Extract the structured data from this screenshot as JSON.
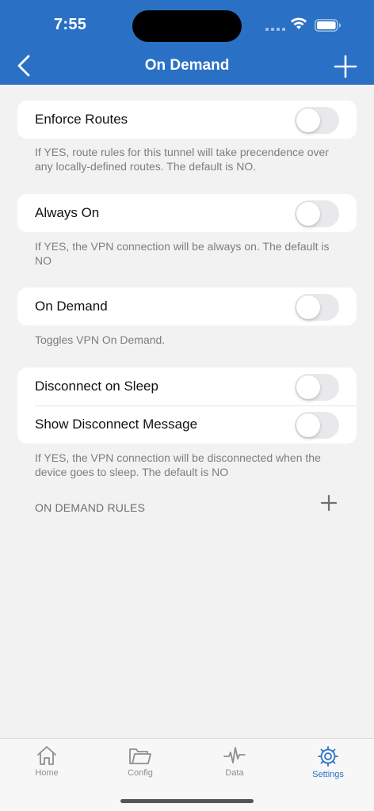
{
  "status_bar": {
    "time": "7:55"
  },
  "nav": {
    "title": "On Demand"
  },
  "groups": [
    {
      "label": "Enforce Routes",
      "enabled": false,
      "footnote": "If YES, route rules for this tunnel will take precendence over any locally-defined routes. The default is NO."
    },
    {
      "label": "Always On",
      "enabled": false,
      "footnote": "If YES, the VPN connection will be always on. The default is NO"
    },
    {
      "label": "On Demand",
      "enabled": false,
      "footnote": "Toggles VPN On Demand."
    }
  ],
  "sleep_group": {
    "rows": [
      {
        "label": "Disconnect on Sleep",
        "enabled": false
      },
      {
        "label": "Show Disconnect Message",
        "enabled": false
      }
    ],
    "footnote": "If YES, the VPN connection will be disconnected when the device goes to sleep. The default is NO"
  },
  "rules_section": {
    "header": "ON DEMAND RULES"
  },
  "tabbar": {
    "active": "Settings",
    "tabs": [
      {
        "label": "Home",
        "icon": "home-icon"
      },
      {
        "label": "Config",
        "icon": "folder-icon"
      },
      {
        "label": "Data",
        "icon": "activity-icon"
      },
      {
        "label": "Settings",
        "icon": "gear-icon"
      }
    ]
  },
  "colors": {
    "header": "#2a71c5",
    "active_tab": "#2a71c5",
    "background": "#f2f2f2"
  }
}
